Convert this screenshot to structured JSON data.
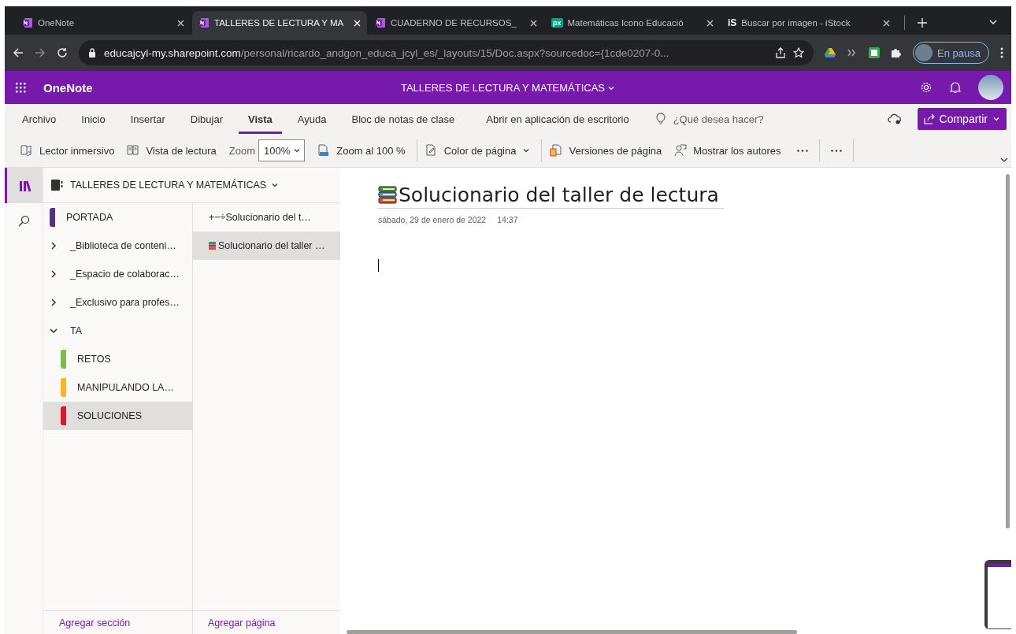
{
  "browser": {
    "tabs": [
      {
        "title": "OneNote",
        "selected": false,
        "favicon": {
          "kind": "onenote"
        }
      },
      {
        "title": "TALLERES DE LECTURA Y MA",
        "selected": true,
        "favicon": {
          "kind": "onenote"
        }
      },
      {
        "title": "CUADERNO DE RECURSOS_",
        "selected": false,
        "favicon": {
          "kind": "onenote"
        }
      },
      {
        "title": "Matemáticas Icono Educació",
        "selected": false,
        "favicon": {
          "kind": "badge",
          "text": "px"
        }
      },
      {
        "title": "Buscar por imagen - iStock",
        "selected": false,
        "favicon": {
          "kind": "letters",
          "text": "iS"
        }
      }
    ],
    "address": {
      "host": "educajcyl-my.sharepoint.com",
      "path": "/personal/ricardo_andgon_educa_jcyl_es/_layouts/15/Doc.aspx?sourcedoc={1cde0207-0..."
    },
    "profile": {
      "label": "En pausa"
    }
  },
  "app": {
    "name": "OneNote",
    "notebook_title": "TALLERES DE LECTURA Y MATEMÁTICAS"
  },
  "ribbon": {
    "tabs": [
      {
        "label": "Archivo",
        "selected": false
      },
      {
        "label": "Inicio",
        "selected": false
      },
      {
        "label": "Insertar",
        "selected": false
      },
      {
        "label": "Dibujar",
        "selected": false
      },
      {
        "label": "Vista",
        "selected": true
      },
      {
        "label": "Ayuda",
        "selected": false
      },
      {
        "label": "Bloc de notas de clase",
        "selected": false
      }
    ],
    "open_desktop": "Abrir en aplicación de escritorio",
    "search": {
      "placeholder": "¿Qué desea hacer?"
    },
    "share": "Compartir"
  },
  "toolbar": {
    "items": [
      {
        "kind": "button",
        "label": "Lector inmersivo"
      },
      {
        "kind": "button",
        "label": "Vista de lectura"
      },
      {
        "kind": "label",
        "label": "Zoom"
      },
      {
        "kind": "select",
        "value": "100%"
      },
      {
        "kind": "button",
        "label": "Zoom al 100 %"
      },
      {
        "kind": "separator"
      },
      {
        "kind": "dropdown",
        "label": "Color de página"
      },
      {
        "kind": "separator"
      },
      {
        "kind": "button",
        "label": "Versiones de página"
      },
      {
        "kind": "button",
        "label": "Mostrar los autores"
      },
      {
        "kind": "more"
      },
      {
        "kind": "separator"
      },
      {
        "kind": "more"
      },
      {
        "kind": "separator"
      }
    ]
  },
  "rail": {
    "items": [
      {
        "selected": true
      },
      {
        "selected": false
      }
    ]
  },
  "notebook": {
    "title": "TALLERES DE LECTURA Y MATEMÁTICAS",
    "sections": [
      {
        "kind": "section",
        "name": "PORTADA",
        "color": "#5c2d91",
        "selected": false
      },
      {
        "kind": "group",
        "name": "_Biblioteca de conteni…",
        "expanded": false
      },
      {
        "kind": "group",
        "name": "_Espacio de colaborac…",
        "expanded": false
      },
      {
        "kind": "group",
        "name": "_Exclusivo para profes…",
        "expanded": false
      },
      {
        "kind": "group",
        "name": "TA",
        "expanded": true,
        "children": [
          {
            "kind": "section",
            "name": "RETOS",
            "color": "#7ac143",
            "selected": false
          },
          {
            "kind": "section",
            "name": "MANIPULANDO LA…",
            "color": "#fdb813",
            "selected": false
          },
          {
            "kind": "section",
            "name": "SOLUCIONES",
            "color": "#e8112d",
            "selected": true
          }
        ]
      }
    ],
    "pages": [
      {
        "kind": "plain",
        "title": "+−÷Solucionario del t…",
        "selected": false
      },
      {
        "kind": "with-icon",
        "title": "Solucionario del taller …",
        "selected": true
      }
    ],
    "add_section": "Agregar sección",
    "add_page": "Agregar página"
  },
  "page": {
    "title": "Solucionario del taller de lectura",
    "date": "sábado, 29 de enero de 2022",
    "time": "14:37"
  }
}
